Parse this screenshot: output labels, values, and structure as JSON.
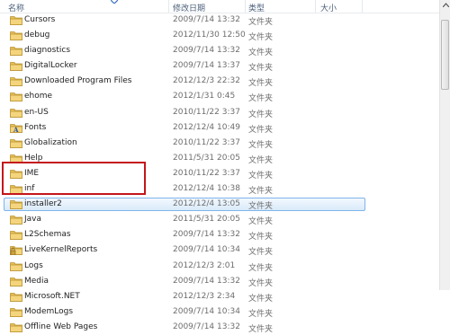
{
  "header": {
    "name_label": "名称",
    "date_label": "修改日期",
    "type_label": "类型",
    "size_label": "大小"
  },
  "files": [
    {
      "name": "Cursors",
      "date": "2009/7/14 13:32",
      "type": "文件夹",
      "icon": "folder-icon"
    },
    {
      "name": "debug",
      "date": "2012/11/30 12:50",
      "type": "文件夹",
      "icon": "folder-icon"
    },
    {
      "name": "diagnostics",
      "date": "2009/7/14 13:32",
      "type": "文件夹",
      "icon": "folder-icon"
    },
    {
      "name": "DigitalLocker",
      "date": "2009/7/14 13:37",
      "type": "文件夹",
      "icon": "folder-icon"
    },
    {
      "name": "Downloaded Program Files",
      "date": "2012/12/3 22:32",
      "type": "文件夹",
      "icon": "folder-icon"
    },
    {
      "name": "ehome",
      "date": "2012/1/31 0:45",
      "type": "文件夹",
      "icon": "folder-icon"
    },
    {
      "name": "en-US",
      "date": "2010/11/22 3:37",
      "type": "文件夹",
      "icon": "folder-icon"
    },
    {
      "name": "Fonts",
      "date": "2012/12/4 10:49",
      "type": "文件夹",
      "icon": "fonts-folder-icon"
    },
    {
      "name": "Globalization",
      "date": "2010/11/22 3:37",
      "type": "文件夹",
      "icon": "folder-icon"
    },
    {
      "name": "Help",
      "date": "2011/5/31 20:05",
      "type": "文件夹",
      "icon": "folder-icon"
    },
    {
      "name": "IME",
      "date": "2010/11/22 3:37",
      "type": "文件夹",
      "icon": "folder-icon"
    },
    {
      "name": "inf",
      "date": "2012/12/4 10:38",
      "type": "文件夹",
      "icon": "folder-icon"
    },
    {
      "name": "installer2",
      "date": "2012/12/4 13:05",
      "type": "文件夹",
      "icon": "folder-icon",
      "selected": true
    },
    {
      "name": "Java",
      "date": "2011/5/31 20:05",
      "type": "文件夹",
      "icon": "folder-icon"
    },
    {
      "name": "L2Schemas",
      "date": "2009/7/14 13:32",
      "type": "文件夹",
      "icon": "folder-icon"
    },
    {
      "name": "LiveKernelReports",
      "date": "2009/7/14 10:34",
      "type": "文件夹",
      "icon": "locked-folder-icon"
    },
    {
      "name": "Logs",
      "date": "2012/12/3 2:01",
      "type": "文件夹",
      "icon": "folder-icon"
    },
    {
      "name": "Media",
      "date": "2009/7/14 13:32",
      "type": "文件夹",
      "icon": "folder-icon"
    },
    {
      "name": "Microsoft.NET",
      "date": "2012/12/3 2:34",
      "type": "文件夹",
      "icon": "folder-icon"
    },
    {
      "name": "ModemLogs",
      "date": "2009/7/14 10:34",
      "type": "文件夹",
      "icon": "folder-icon"
    },
    {
      "name": "Offline Web Pages",
      "date": "2009/7/14 13:32",
      "type": "文件夹",
      "icon": "folder-icon"
    }
  ],
  "colors": {
    "selection_border": "#7eb4ea",
    "highlight_box": "#c4161c",
    "folder": "#e8c05a"
  }
}
